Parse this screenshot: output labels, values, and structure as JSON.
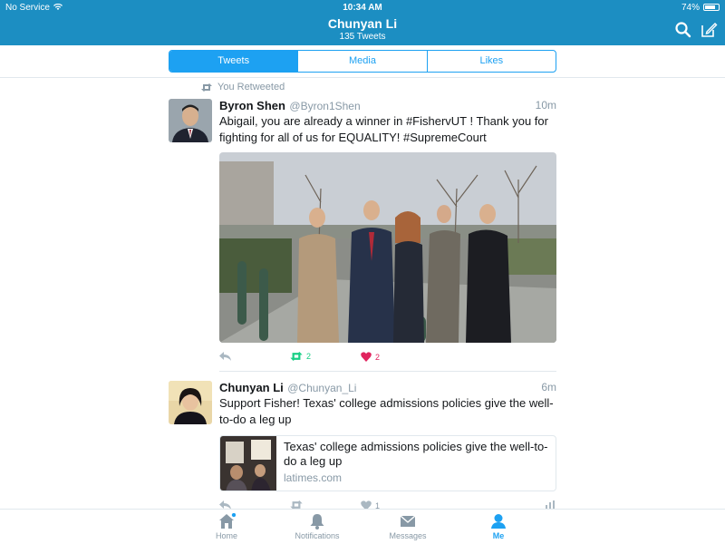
{
  "status": {
    "carrier": "No Service",
    "time": "10:34 AM",
    "battery": "74%"
  },
  "header": {
    "name": "Chunyan Li",
    "tweet_count": "135 Tweets"
  },
  "tabs": [
    "Tweets",
    "Media",
    "Likes"
  ],
  "tweets": [
    {
      "retweet_note": "You Retweeted",
      "name": "Byron Shen",
      "handle": "@Byron1Shen",
      "time": "10m",
      "text": "Abigail, you are already a winner in #FishervUT ! Thank you for fighting for all of us for EQUALITY! #SupremeCourt",
      "retweets": "2",
      "likes": "2"
    },
    {
      "name": "Chunyan Li",
      "handle": "@Chunyan_Li",
      "time": "6m",
      "text": "Support Fisher! Texas' college admissions policies give the well-to-do a leg up",
      "card": {
        "title": "Texas' college admissions policies give the well-to-do a leg up",
        "domain": "latimes.com"
      },
      "likes": "1"
    }
  ],
  "bottom_tabs": [
    "Home",
    "Notifications",
    "Messages",
    "Me"
  ]
}
